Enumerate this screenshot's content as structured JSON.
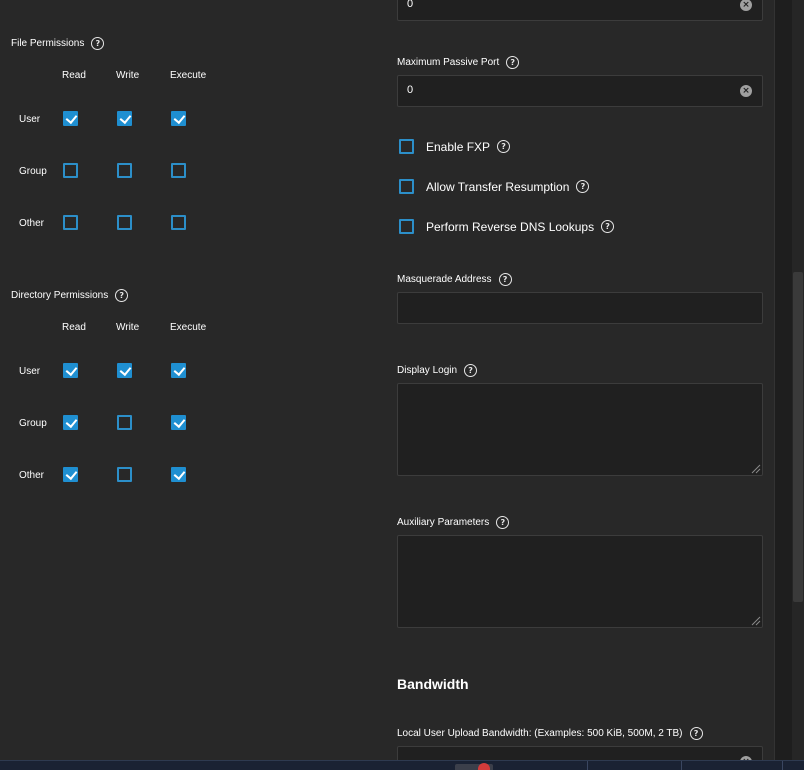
{
  "file_permissions": {
    "title": "File Permissions",
    "columns": [
      "Read",
      "Write",
      "Execute"
    ],
    "rows": [
      {
        "label": "User",
        "values": [
          true,
          true,
          true
        ]
      },
      {
        "label": "Group",
        "values": [
          false,
          false,
          false
        ]
      },
      {
        "label": "Other",
        "values": [
          false,
          false,
          false
        ]
      }
    ]
  },
  "directory_permissions": {
    "title": "Directory Permissions",
    "columns": [
      "Read",
      "Write",
      "Execute"
    ],
    "rows": [
      {
        "label": "User",
        "values": [
          true,
          true,
          true
        ]
      },
      {
        "label": "Group",
        "values": [
          true,
          false,
          true
        ]
      },
      {
        "label": "Other",
        "values": [
          true,
          false,
          true
        ]
      }
    ]
  },
  "minimum_passive_port": {
    "value": "0"
  },
  "maximum_passive_port": {
    "label": "Maximum Passive Port",
    "value": "0"
  },
  "options": {
    "enable_fxp": {
      "label": "Enable FXP",
      "checked": false
    },
    "allow_transfer_resumption": {
      "label": "Allow Transfer Resumption",
      "checked": false
    },
    "perform_reverse_dns": {
      "label": "Perform Reverse DNS Lookups",
      "checked": false
    }
  },
  "masquerade_address": {
    "label": "Masquerade Address",
    "value": ""
  },
  "display_login": {
    "label": "Display Login",
    "value": ""
  },
  "auxiliary_parameters": {
    "label": "Auxiliary Parameters",
    "value": ""
  },
  "bandwidth": {
    "heading": "Bandwidth",
    "local_user_upload_label": "Local User Upload Bandwidth: (Examples: 500 KiB, 500M, 2 TB)"
  },
  "icons": {
    "help": "help-circle-icon",
    "clear": "clear-circle-icon",
    "resize": "resize-grip-icon"
  },
  "colors": {
    "accent": "#1f8fd1",
    "background": "#282828",
    "input_bg": "#202020"
  }
}
